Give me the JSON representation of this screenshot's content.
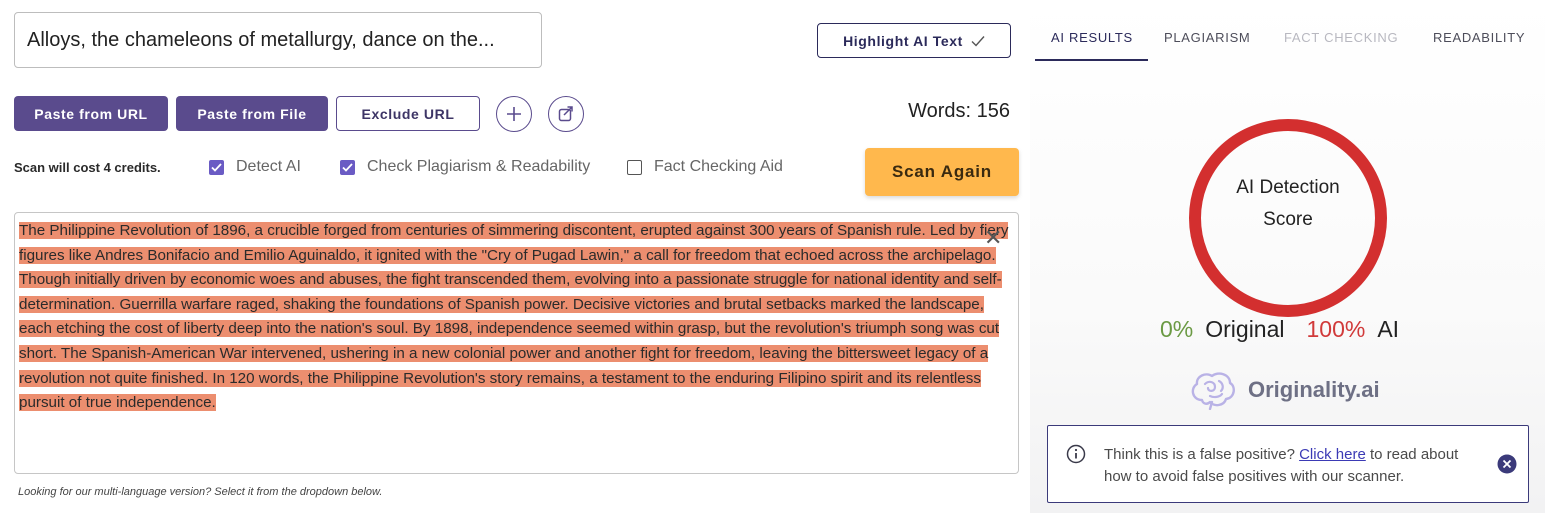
{
  "input": {
    "title_value": "Alloys, the chameleons of metallurgy, dance on the..."
  },
  "toolbar": {
    "highlight_label": "Highlight AI Text",
    "paste_url_label": "Paste from URL",
    "paste_file_label": "Paste from File",
    "exclude_url_label": "Exclude URL",
    "plus_icon_glyph": "+",
    "words_text": "Words: 156"
  },
  "options": {
    "cost_text": "Scan will cost 4 credits.",
    "detect_ai": {
      "label": "Detect AI",
      "checked": true
    },
    "check_plagiarism": {
      "label": "Check Plagiarism & Readability",
      "checked": true
    },
    "fact_checking": {
      "label": "Fact Checking Aid",
      "checked": false
    },
    "scan_label": "Scan Again"
  },
  "editor": {
    "text": "The Philippine Revolution of 1896, a crucible forged from centuries of simmering discontent, erupted against 300 years of Spanish rule. Led by fiery figures like Andres Bonifacio and Emilio Aguinaldo, it ignited with the \"Cry of Pugad Lawin,\" a call for freedom that echoed across the archipelago. Though initially driven by economic woes and abuses, the fight transcended them, evolving into a passionate struggle for national identity and self-determination. Guerrilla warfare raged, shaking the foundations of Spanish power. Decisive victories and brutal setbacks marked the landscape, each etching the cost of liberty deep into the nation's soul. By 1898, independence seemed within grasp, but the revolution's triumph song was cut short. The Spanish-American War intervened, ushering in a new colonial power and another fight for freedom, leaving the bittersweet legacy of a revolution not quite finished. In 120 words, the Philippine Revolution's story remains, a testament to the enduring Filipino spirit and its relentless pursuit of true independence.",
    "clear_glyph": "✕",
    "highlight_color": "#ec8e6f"
  },
  "hint_text": "Looking for our multi-language version? Select it from the dropdown below.",
  "tabs": [
    {
      "label": "AI RESULTS",
      "state": "active"
    },
    {
      "label": "PLAGIARISM",
      "state": "normal"
    },
    {
      "label": "FACT CHECKING",
      "state": "disabled"
    },
    {
      "label": "READABILITY",
      "state": "normal"
    }
  ],
  "result": {
    "gauge_label_line1": "AI Detection",
    "gauge_label_line2": "Score",
    "ai_fraction": 1.0,
    "original_pct": "0%",
    "original_label": "Original",
    "ai_pct": "100%",
    "ai_label": "AI",
    "gauge_color": "#d32f2f",
    "original_color": "#6b9a44",
    "ai_color": "#d13a3a"
  },
  "brand": {
    "name": "Originality.ai"
  },
  "notice": {
    "text_before": "Think this is a false positive? ",
    "link": "Click here",
    "text_after": " to read about how to avoid false positives with our scanner."
  },
  "colors": {
    "primary": "#5a4b8d",
    "scan_button": "#ffb84d",
    "checkbox": "#6a5bc4"
  }
}
